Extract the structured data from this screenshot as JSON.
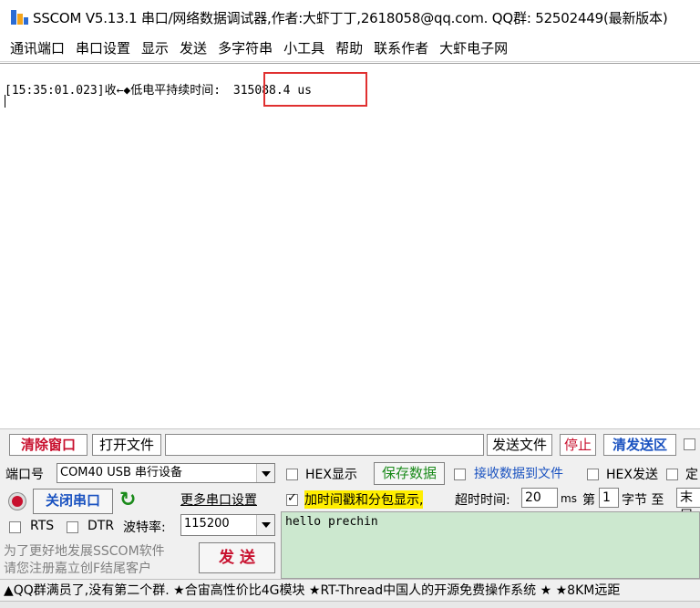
{
  "titlebar": {
    "icon": "sscom-bar-icon",
    "title": "SSCOM V5.13.1 串口/网络数据调试器,作者:大虾丁丁,2618058@qq.com. QQ群: 52502449(最新版本)"
  },
  "menu": [
    "通讯端口",
    "串口设置",
    "显示",
    "发送",
    "多字符串",
    "小工具",
    "帮助",
    "联系作者",
    "大虾电子网"
  ],
  "receive": {
    "timestamp": "[15:35:01.023]",
    "direction": "收←◆",
    "label": "低电平持续时间:",
    "value": "315088.4 us"
  },
  "toolbar": {
    "clear_window": "清除窗口",
    "open_file": "打开文件",
    "file_path": "",
    "send_file": "发送文件",
    "stop": "停止",
    "clear_send": "清发送区"
  },
  "port": {
    "port_label": "端口号",
    "port_value": "COM40 USB 串行设备",
    "close_port": "关闭串口",
    "more_settings": "更多串口设置",
    "rts": "RTS",
    "dtr": "DTR",
    "baud_label": "波特率:",
    "baud_value": "115200"
  },
  "options": {
    "hex_display": "HEX显示",
    "save_data": "保存数据",
    "recv_to_file": "接收数据到文件",
    "hex_send": "HEX发送",
    "timed": "定",
    "add_timestamp": "加时间戳和分包显示,",
    "timeout_label": "超时时间:",
    "timeout_value": "20",
    "timeout_unit": "ms",
    "nth_label": "第",
    "nth_value": "1",
    "byte_label": "字节 至",
    "end_label": "末尾"
  },
  "send": {
    "promo_line1": "为了更好地发展SSCOM软件",
    "promo_line2": "请您注册嘉立创F结尾客户",
    "send_button": "发  送",
    "text": "hello prechin"
  },
  "ticker": "▲QQ群满员了,没有第二个群. ★合宙高性价比4G模块 ★RT-Thread中国人的开源免费操作系统 ★ ★8KM远距"
}
